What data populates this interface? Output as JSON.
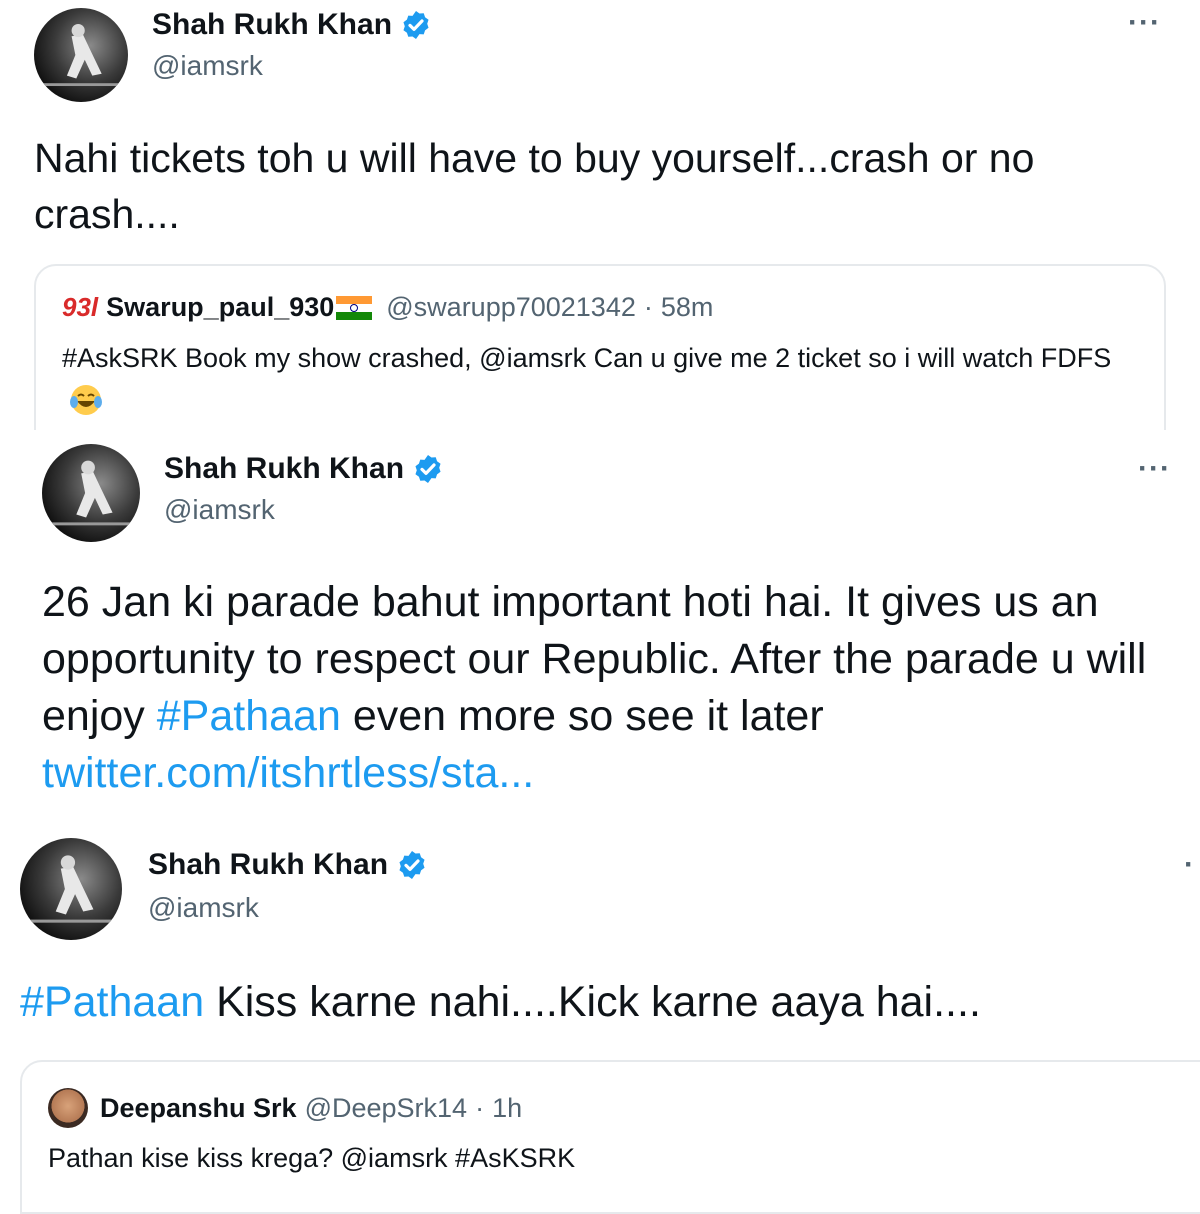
{
  "colors": {
    "link": "#1d9bf0",
    "verified": "#1d9bf0",
    "secondary": "#536471"
  },
  "tweet1": {
    "name": "Shah Rukh Khan",
    "handle": "@iamsrk",
    "more": "···",
    "text": "Nahi tickets toh u will have to buy yourself...crash or no crash....",
    "quote": {
      "logo": "93l",
      "name": "Swarup_paul_930",
      "handle": "@swarupp70021342",
      "separator": "·",
      "time": "58m",
      "text": "#AskSRK Book my show crashed, @iamsrk Can u give me 2 ticket so i will watch FDFS"
    }
  },
  "tweet2": {
    "name": "Shah Rukh Khan",
    "handle": "@iamsrk",
    "more": "···",
    "text_before": "26 Jan ki parade bahut important hoti hai. It gives us an opportunity to respect our Republic. After the parade u will enjoy ",
    "hashtag": "#Pathaan",
    "text_after": " even more so see it later",
    "link": "twitter.com/itshrtless/sta..."
  },
  "tweet3": {
    "name": "Shah Rukh Khan",
    "handle": "@iamsrk",
    "more": "·",
    "hashtag": "#Pathaan",
    "text_after": " Kiss karne nahi....Kick karne aaya hai....",
    "quote": {
      "name": "Deepanshu Srk",
      "handle": "@DeepSrk14",
      "separator": "·",
      "time": "1h",
      "text": "Pathan kise kiss krega? @iamsrk #AsKSRK"
    }
  }
}
